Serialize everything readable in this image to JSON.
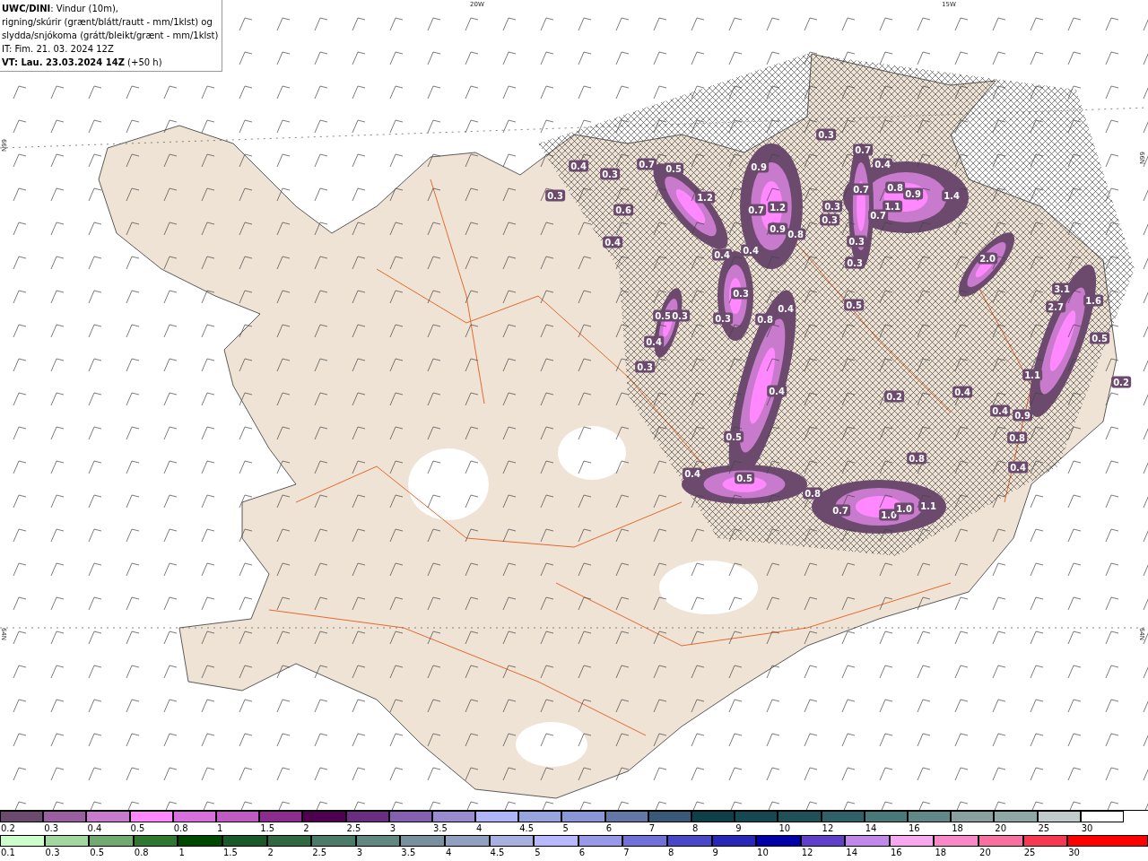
{
  "header": {
    "lines": [
      "**UWC/DINI**: Vindur (10m),",
      "rigning/skúrir (grænt/blátt/rautt - mm/1klst) og",
      "slydda/snjókoma (grátt/bleikt/grænt - mm/1klst)",
      "IT: Fim. 21. 03. 2024 12Z",
      "**VT: Lau. 23.03.2024 14Z** (+50 h)"
    ]
  },
  "axis_labels": [
    "20W",
    "15W",
    "66N",
    "66N",
    "64N",
    "64N"
  ],
  "map_values": [
    "0.4",
    "0.3",
    "0.3",
    "0.6",
    "0.4",
    "0.7",
    "0.5",
    "1.2",
    "0.9",
    "0.7",
    "1.2",
    "0.9",
    "0.8",
    "0.4",
    "0.4",
    "0.3",
    "0.3",
    "0.4",
    "0.8",
    "0.5",
    "0.3",
    "0.4",
    "0.3",
    "0.3",
    "0.3",
    "0.3",
    "0.7",
    "0.4",
    "0.7",
    "0.8",
    "0.9",
    "1.4",
    "1.1",
    "0.7",
    "0.3",
    "0.3",
    "2.0",
    "3.1",
    "1.6",
    "2.7",
    "0.5",
    "0.5",
    "1.1",
    "0.2",
    "0.4",
    "0.9",
    "0.4",
    "0.8",
    "0.4",
    "0.8",
    "0.2",
    "0.4",
    "0.5",
    "0.4",
    "0.5",
    "0.8",
    "0.7",
    "1.0",
    "1.0",
    "1.1"
  ],
  "colorbar_1": [
    {
      "label": "0.2",
      "color": "#6b4a6e"
    },
    {
      "label": "0.3",
      "color": "#9b5ea0"
    },
    {
      "label": "0.4",
      "color": "#c87acc"
    },
    {
      "label": "0.5",
      "color": "#ff88ff"
    },
    {
      "label": "0.8",
      "color": "#d86fdc"
    },
    {
      "label": "1",
      "color": "#c05bc4"
    },
    {
      "label": "1.5",
      "color": "#8b2c8e"
    },
    {
      "label": "2",
      "color": "#4f0050"
    },
    {
      "label": "2.5",
      "color": "#6a2d80"
    },
    {
      "label": "3",
      "color": "#8560b0"
    },
    {
      "label": "3.5",
      "color": "#9a8ad0"
    },
    {
      "label": "4",
      "color": "#b0b4f8"
    },
    {
      "label": "4.5",
      "color": "#98a4e0"
    },
    {
      "label": "5",
      "color": "#8a96d8"
    },
    {
      "label": "6",
      "color": "#6478a8"
    },
    {
      "label": "7",
      "color": "#3a5878"
    },
    {
      "label": "8",
      "color": "#0d4048"
    },
    {
      "label": "9",
      "color": "#154850"
    },
    {
      "label": "10",
      "color": "#205058"
    },
    {
      "label": "12",
      "color": "#306068"
    },
    {
      "label": "14",
      "color": "#487878"
    },
    {
      "label": "16",
      "color": "#608888"
    },
    {
      "label": "18",
      "color": "#88a0a0"
    },
    {
      "label": "20",
      "color": "#8ea8a8"
    },
    {
      "label": "25",
      "color": "#c0cccc"
    },
    {
      "label": "30",
      "color": "#ffffff"
    }
  ],
  "colorbar_2": [
    {
      "label": "0.1",
      "color": "#ccffcc"
    },
    {
      "label": "0.3",
      "color": "#a0d8a0"
    },
    {
      "label": "0.5",
      "color": "#70aa70"
    },
    {
      "label": "0.8",
      "color": "#307830"
    },
    {
      "label": "1",
      "color": "#004800"
    },
    {
      "label": "1.5",
      "color": "#1a5a28"
    },
    {
      "label": "2",
      "color": "#306840"
    },
    {
      "label": "2.5",
      "color": "#4a7a68"
    },
    {
      "label": "3",
      "color": "#608880"
    },
    {
      "label": "3.5",
      "color": "#7890a0"
    },
    {
      "label": "4",
      "color": "#90a0c0"
    },
    {
      "label": "4.5",
      "color": "#a8b0e0"
    },
    {
      "label": "5",
      "color": "#b8b8ff"
    },
    {
      "label": "6",
      "color": "#9898e8"
    },
    {
      "label": "7",
      "color": "#7070d8"
    },
    {
      "label": "8",
      "color": "#4848c8"
    },
    {
      "label": "9",
      "color": "#2828b8"
    },
    {
      "label": "10",
      "color": "#0000a8"
    },
    {
      "label": "12",
      "color": "#6040c8"
    },
    {
      "label": "14",
      "color": "#c088e8"
    },
    {
      "label": "16",
      "color": "#f8a8f0"
    },
    {
      "label": "18",
      "color": "#f888c8"
    },
    {
      "label": "20",
      "color": "#f870a0"
    },
    {
      "label": "25",
      "color": "#f83850"
    },
    {
      "label": "30",
      "color": "#ff0000"
    }
  ]
}
